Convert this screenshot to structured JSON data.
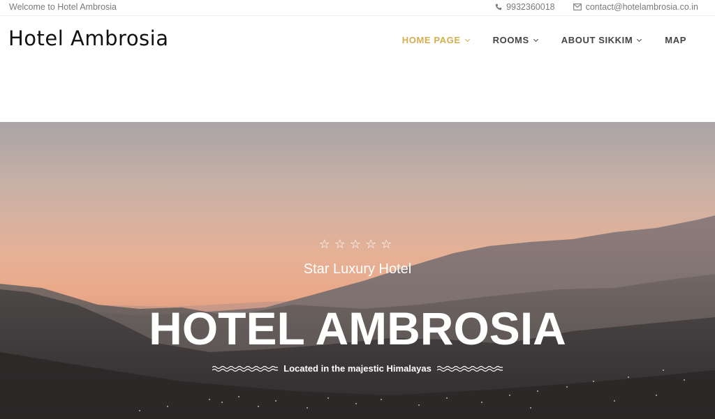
{
  "topbar": {
    "welcome": "Welcome to Hotel Ambrosia",
    "phone": "9932360018",
    "email": "contact@hotelambrosia.co.in",
    "phone_icon": "phone-icon",
    "email_icon": "envelope-icon"
  },
  "header": {
    "logo": "Hotel Ambrosia",
    "nav": [
      {
        "label": "HOME PAGE",
        "active": true,
        "dropdown": true
      },
      {
        "label": "ROOMS",
        "active": false,
        "dropdown": true
      },
      {
        "label": "ABOUT SIKKIM",
        "active": false,
        "dropdown": true
      },
      {
        "label": "MAP",
        "active": false,
        "dropdown": false
      }
    ],
    "accent_color": "#d4ae4f"
  },
  "hero": {
    "stars": [
      "☆",
      "☆",
      "☆",
      "☆",
      "☆"
    ],
    "subtitle": "Star Luxury Hotel",
    "title": "HOTEL AMBROSIA",
    "tagline": "Located in the majestic Himalayas",
    "wave_icon": "wave-divider-icon"
  }
}
